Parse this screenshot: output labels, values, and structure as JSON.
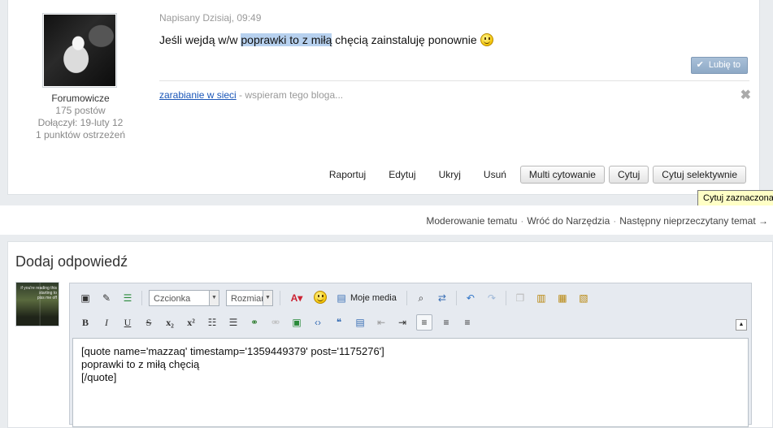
{
  "post": {
    "date": "Napisany Dzisiaj, 09:49",
    "text_before": "Jeśli wejdą w/w ",
    "text_highlight": "poprawki to z miłą",
    "text_after": " chęcią zainstaluję ponownie",
    "like_label": "Lubię to",
    "author": {
      "name": "Forumowicze",
      "posts": "175 postów",
      "joined": "Dołączył: 19-luty 12",
      "warnings": "1 punktów ostrzeżeń"
    },
    "signature_link": "zarabianie w sieci",
    "signature_text": " - wspieram tego bloga...",
    "actions": {
      "report": "Raportuj",
      "edit": "Edytuj",
      "hide": "Ukryj",
      "delete": "Usuń",
      "multiquote": "Multi cytowanie",
      "quote": "Cytuj",
      "selective_quote": "Cytuj selektywnie"
    },
    "tooltip": "Cytuj zaznaczona"
  },
  "nav": {
    "moderate": "Moderowanie tematu",
    "back": "Wróć do Narzędzia",
    "next": "Następny nieprzeczytany temat →"
  },
  "reply": {
    "title": "Dodaj odpowiedź",
    "avatar_caption": "if you're reading this\nstarting to\npiss me off",
    "font_select": "Czcionka",
    "size_select": "Rozmiar",
    "media_label": "Moje media",
    "content": "[quote name='mazzaq' timestamp='1359449379' post='1175276']\npoprawki to z miłą chęcią\n[/quote]"
  }
}
